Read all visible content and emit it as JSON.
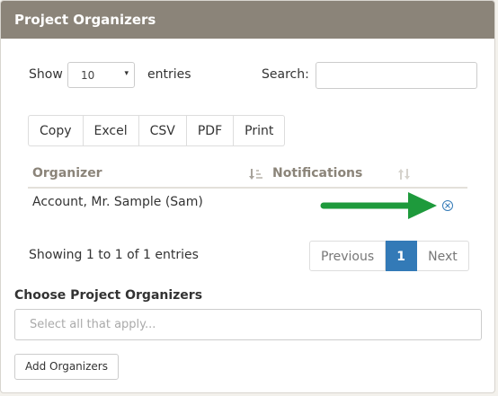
{
  "panel": {
    "title": "Project Organizers"
  },
  "length_menu": {
    "show_label": "Show",
    "selected": "10",
    "entries_label": "entries",
    "caret": "▾"
  },
  "search": {
    "label": "Search:",
    "value": ""
  },
  "export_buttons": [
    "Copy",
    "Excel",
    "CSV",
    "PDF",
    "Print"
  ],
  "table": {
    "columns": [
      {
        "label": "Organizer",
        "sort_icon": "sort-amount-asc-icon"
      },
      {
        "label": "Notifications",
        "sort_icon": "sort-both-icon"
      }
    ],
    "rows": [
      {
        "organizer": "Account, Mr. Sample (Sam)",
        "remove_icon": "circle-x-icon"
      }
    ]
  },
  "info": "Showing 1 to 1 of 1 entries",
  "pagination": {
    "previous": "Previous",
    "current": "1",
    "next": "Next"
  },
  "choose": {
    "title": "Choose Project Organizers",
    "placeholder": "Select all that apply...",
    "add_button": "Add Organizers"
  },
  "colors": {
    "header": "#8b8479",
    "active_page": "#337ab7",
    "arrow": "#1e9a3c"
  }
}
